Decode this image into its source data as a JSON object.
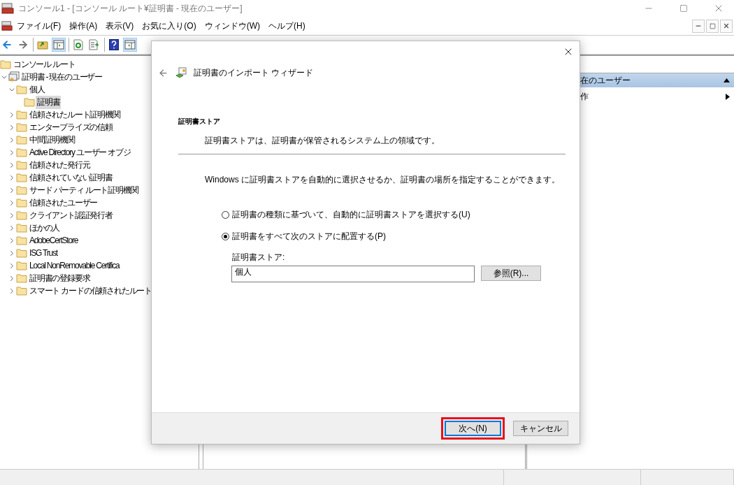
{
  "window": {
    "title": "コンソール1 - [コンソール ルート¥証明書 - 現在のユーザー]"
  },
  "menu": [
    "ファイル(F)",
    "操作(A)",
    "表示(V)",
    "お気に入り(O)",
    "ウィンドウ(W)",
    "ヘルプ(H)"
  ],
  "toolbar": [
    [
      {
        "kind": "back",
        "pressed": false
      },
      {
        "kind": "forward",
        "pressed": false
      }
    ],
    [
      {
        "kind": "up",
        "pressed": false
      },
      {
        "kind": "tree",
        "pressed": true
      }
    ],
    [
      {
        "kind": "refresh",
        "pressed": false
      },
      {
        "kind": "export",
        "pressed": false
      }
    ],
    [
      {
        "kind": "help",
        "pressed": false
      },
      {
        "kind": "action",
        "pressed": true
      }
    ]
  ],
  "tree": [
    {
      "label": "コンソール ルート",
      "kind": "folder",
      "selected": false,
      "children": [
        {
          "label": "証明書 - 現在のユーザー",
          "kind": "certs",
          "expanded": true,
          "selected": false,
          "children": [
            {
              "label": "個人",
              "kind": "folder",
              "expanded": true,
              "selected": false,
              "children": [
                {
                  "label": "証明書",
                  "kind": "folder",
                  "selected": true
                }
              ]
            },
            {
              "label": "信頼されたルート証明機関",
              "kind": "folder",
              "expanded": false,
              "selected": false
            },
            {
              "label": "エンタープライズの信頼",
              "kind": "folder",
              "expanded": false,
              "selected": false
            },
            {
              "label": "中間証明機関",
              "kind": "folder",
              "expanded": false,
              "selected": false
            },
            {
              "label": "Active Directory ユーザー オブジ",
              "kind": "folder",
              "expanded": false,
              "selected": false
            },
            {
              "label": "信頼された発行元",
              "kind": "folder",
              "expanded": false,
              "selected": false
            },
            {
              "label": "信頼されていない証明書",
              "kind": "folder",
              "expanded": false,
              "selected": false
            },
            {
              "label": "サード パーティ ルート証明機関",
              "kind": "folder",
              "expanded": false,
              "selected": false
            },
            {
              "label": "信頼されたユーザー",
              "kind": "folder",
              "expanded": false,
              "selected": false
            },
            {
              "label": "クライアント認証発行者",
              "kind": "folder",
              "expanded": false,
              "selected": false
            },
            {
              "label": "ほかの人",
              "kind": "folder",
              "expanded": false,
              "selected": false
            },
            {
              "label": "AdobeCertStore",
              "kind": "folder",
              "expanded": false,
              "selected": false
            },
            {
              "label": "ISG Trust",
              "kind": "folder",
              "expanded": false,
              "selected": false
            },
            {
              "label": "Local NonRemovable Certifica",
              "kind": "folder",
              "expanded": false,
              "selected": false
            },
            {
              "label": "証明書の登録要求",
              "kind": "folder",
              "expanded": false,
              "selected": false
            },
            {
              "label": "スマート カードの信頼されたルート",
              "kind": "folder",
              "expanded": false,
              "selected": false
            }
          ]
        }
      ]
    }
  ],
  "actions_pane": {
    "header": "在のユーザー",
    "item": "作"
  },
  "dialog": {
    "title": "証明書のインポート ウィザード",
    "heading": "証明書ストア",
    "subheading": "証明書ストアは、証明書が保管されるシステム上の領域です。",
    "intro": "Windows に証明書ストアを自動的に選択させるか、証明書の場所を指定することができます。",
    "options": [
      {
        "label": "証明書の種類に基づいて、自動的に証明書ストアを選択する(U)",
        "selected": false
      },
      {
        "label": "証明書をすべて次のストアに配置する(P)",
        "selected": true
      }
    ],
    "store_label": "証明書ストア:",
    "store_value": "個人",
    "browse": "参照(R)...",
    "buttons": [
      {
        "label": "次へ(N)",
        "default": true,
        "highlighted": true
      },
      {
        "label": "キャンセル",
        "default": false,
        "highlighted": false
      }
    ]
  }
}
